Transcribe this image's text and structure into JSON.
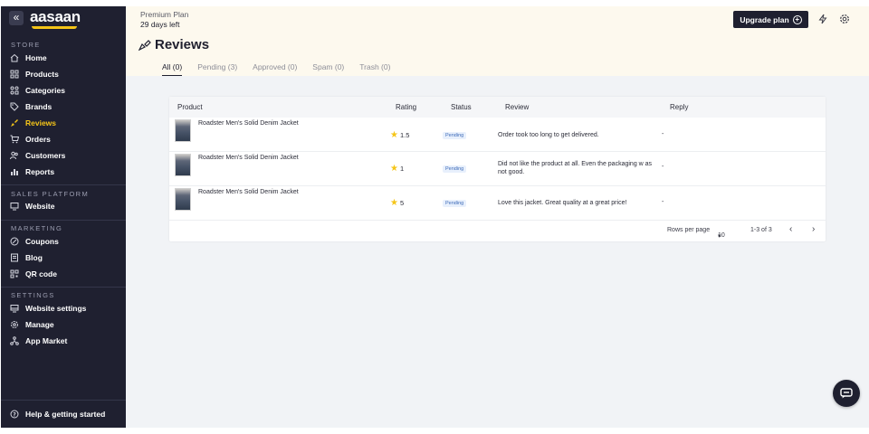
{
  "sidebar": {
    "brand": "aasaan",
    "collapse_icon": "double-chevron-left-icon",
    "sections": {
      "store": "STORE",
      "sales_platform": "SALES PLATFORM",
      "marketing": "MARKETING",
      "settings": "SETTINGS"
    },
    "items": {
      "home": "Home",
      "products": "Products",
      "categories": "Categories",
      "brands": "Brands",
      "reviews": "Reviews",
      "orders": "Orders",
      "customers": "Customers",
      "reports": "Reports",
      "website": "Website",
      "coupons": "Coupons",
      "blog": "Blog",
      "qr_code": "QR code",
      "website_settings": "Website settings",
      "manage": "Manage",
      "app_market": "App Market"
    },
    "help": "Help & getting started",
    "active_item": "reviews",
    "accent_color": "#f5c518"
  },
  "topbar": {
    "plan_name": "Premium Plan",
    "plan_days": "29 days left",
    "upgrade_label": "Upgrade plan",
    "icons": [
      "lightning-icon",
      "gear-icon"
    ]
  },
  "page": {
    "title": "Reviews",
    "tabs": [
      {
        "label": "All (0)",
        "active": true
      },
      {
        "label": "Pending (3)",
        "active": false
      },
      {
        "label": "Approved (0)",
        "active": false
      },
      {
        "label": "Spam (0)",
        "active": false
      },
      {
        "label": "Trash (0)",
        "active": false
      }
    ]
  },
  "table": {
    "headers": {
      "product": "Product",
      "rating": "Rating",
      "status": "Status",
      "review": "Review",
      "reply": "Reply"
    },
    "rows": [
      {
        "product": "Roadster Men's Solid Denim Jacket",
        "rating": "1.5",
        "status": "Pending",
        "review": "Order took too long to get delivered.",
        "reply": "-"
      },
      {
        "product": "Roadster Men's Solid Denim Jacket",
        "rating": "1",
        "status": "Pending",
        "review": "Did not like the product at all. Even the packaging w as not good.",
        "reply": "-"
      },
      {
        "product": "Roadster Men's Solid Denim Jacket",
        "rating": "5",
        "status": "Pending",
        "review": "Love this jacket. Great quality at a great price!",
        "reply": "-"
      }
    ],
    "footer": {
      "rows_per_page_label": "Rows per page",
      "rows_per_page_value": "10",
      "range": "1-3 of 3"
    }
  }
}
